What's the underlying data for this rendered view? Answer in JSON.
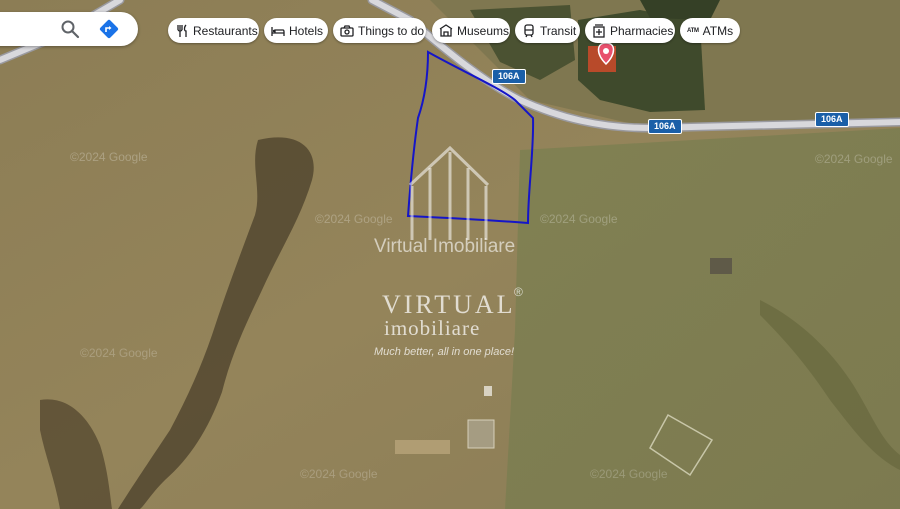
{
  "search": {
    "search_icon": "search-icon",
    "directions_icon": "directions-icon"
  },
  "chips": [
    {
      "label": "Restaurants",
      "icon": "fork-knife-icon"
    },
    {
      "label": "Hotels",
      "icon": "bed-icon"
    },
    {
      "label": "Things to do",
      "icon": "camera-icon"
    },
    {
      "label": "Museums",
      "icon": "museum-icon"
    },
    {
      "label": "Transit",
      "icon": "train-icon"
    },
    {
      "label": "Pharmacies",
      "icon": "pharmacy-icon"
    },
    {
      "label": "ATMs",
      "icon": "atm-icon",
      "icon_text": "ATM"
    }
  ],
  "map": {
    "type": "satellite",
    "road_label": "106A",
    "boundary_color": "#1515c8",
    "road_color": "#c9c9cc",
    "marker_color": "#e8506d",
    "copyright_text": "©2024 Google"
  },
  "watermark": {
    "top_text": "Virtual Imobiliare",
    "brand_line1": "VIRTUAL",
    "registered": "®",
    "brand_line2": "imobiliare",
    "tagline": "Much better,  all in one place!"
  }
}
